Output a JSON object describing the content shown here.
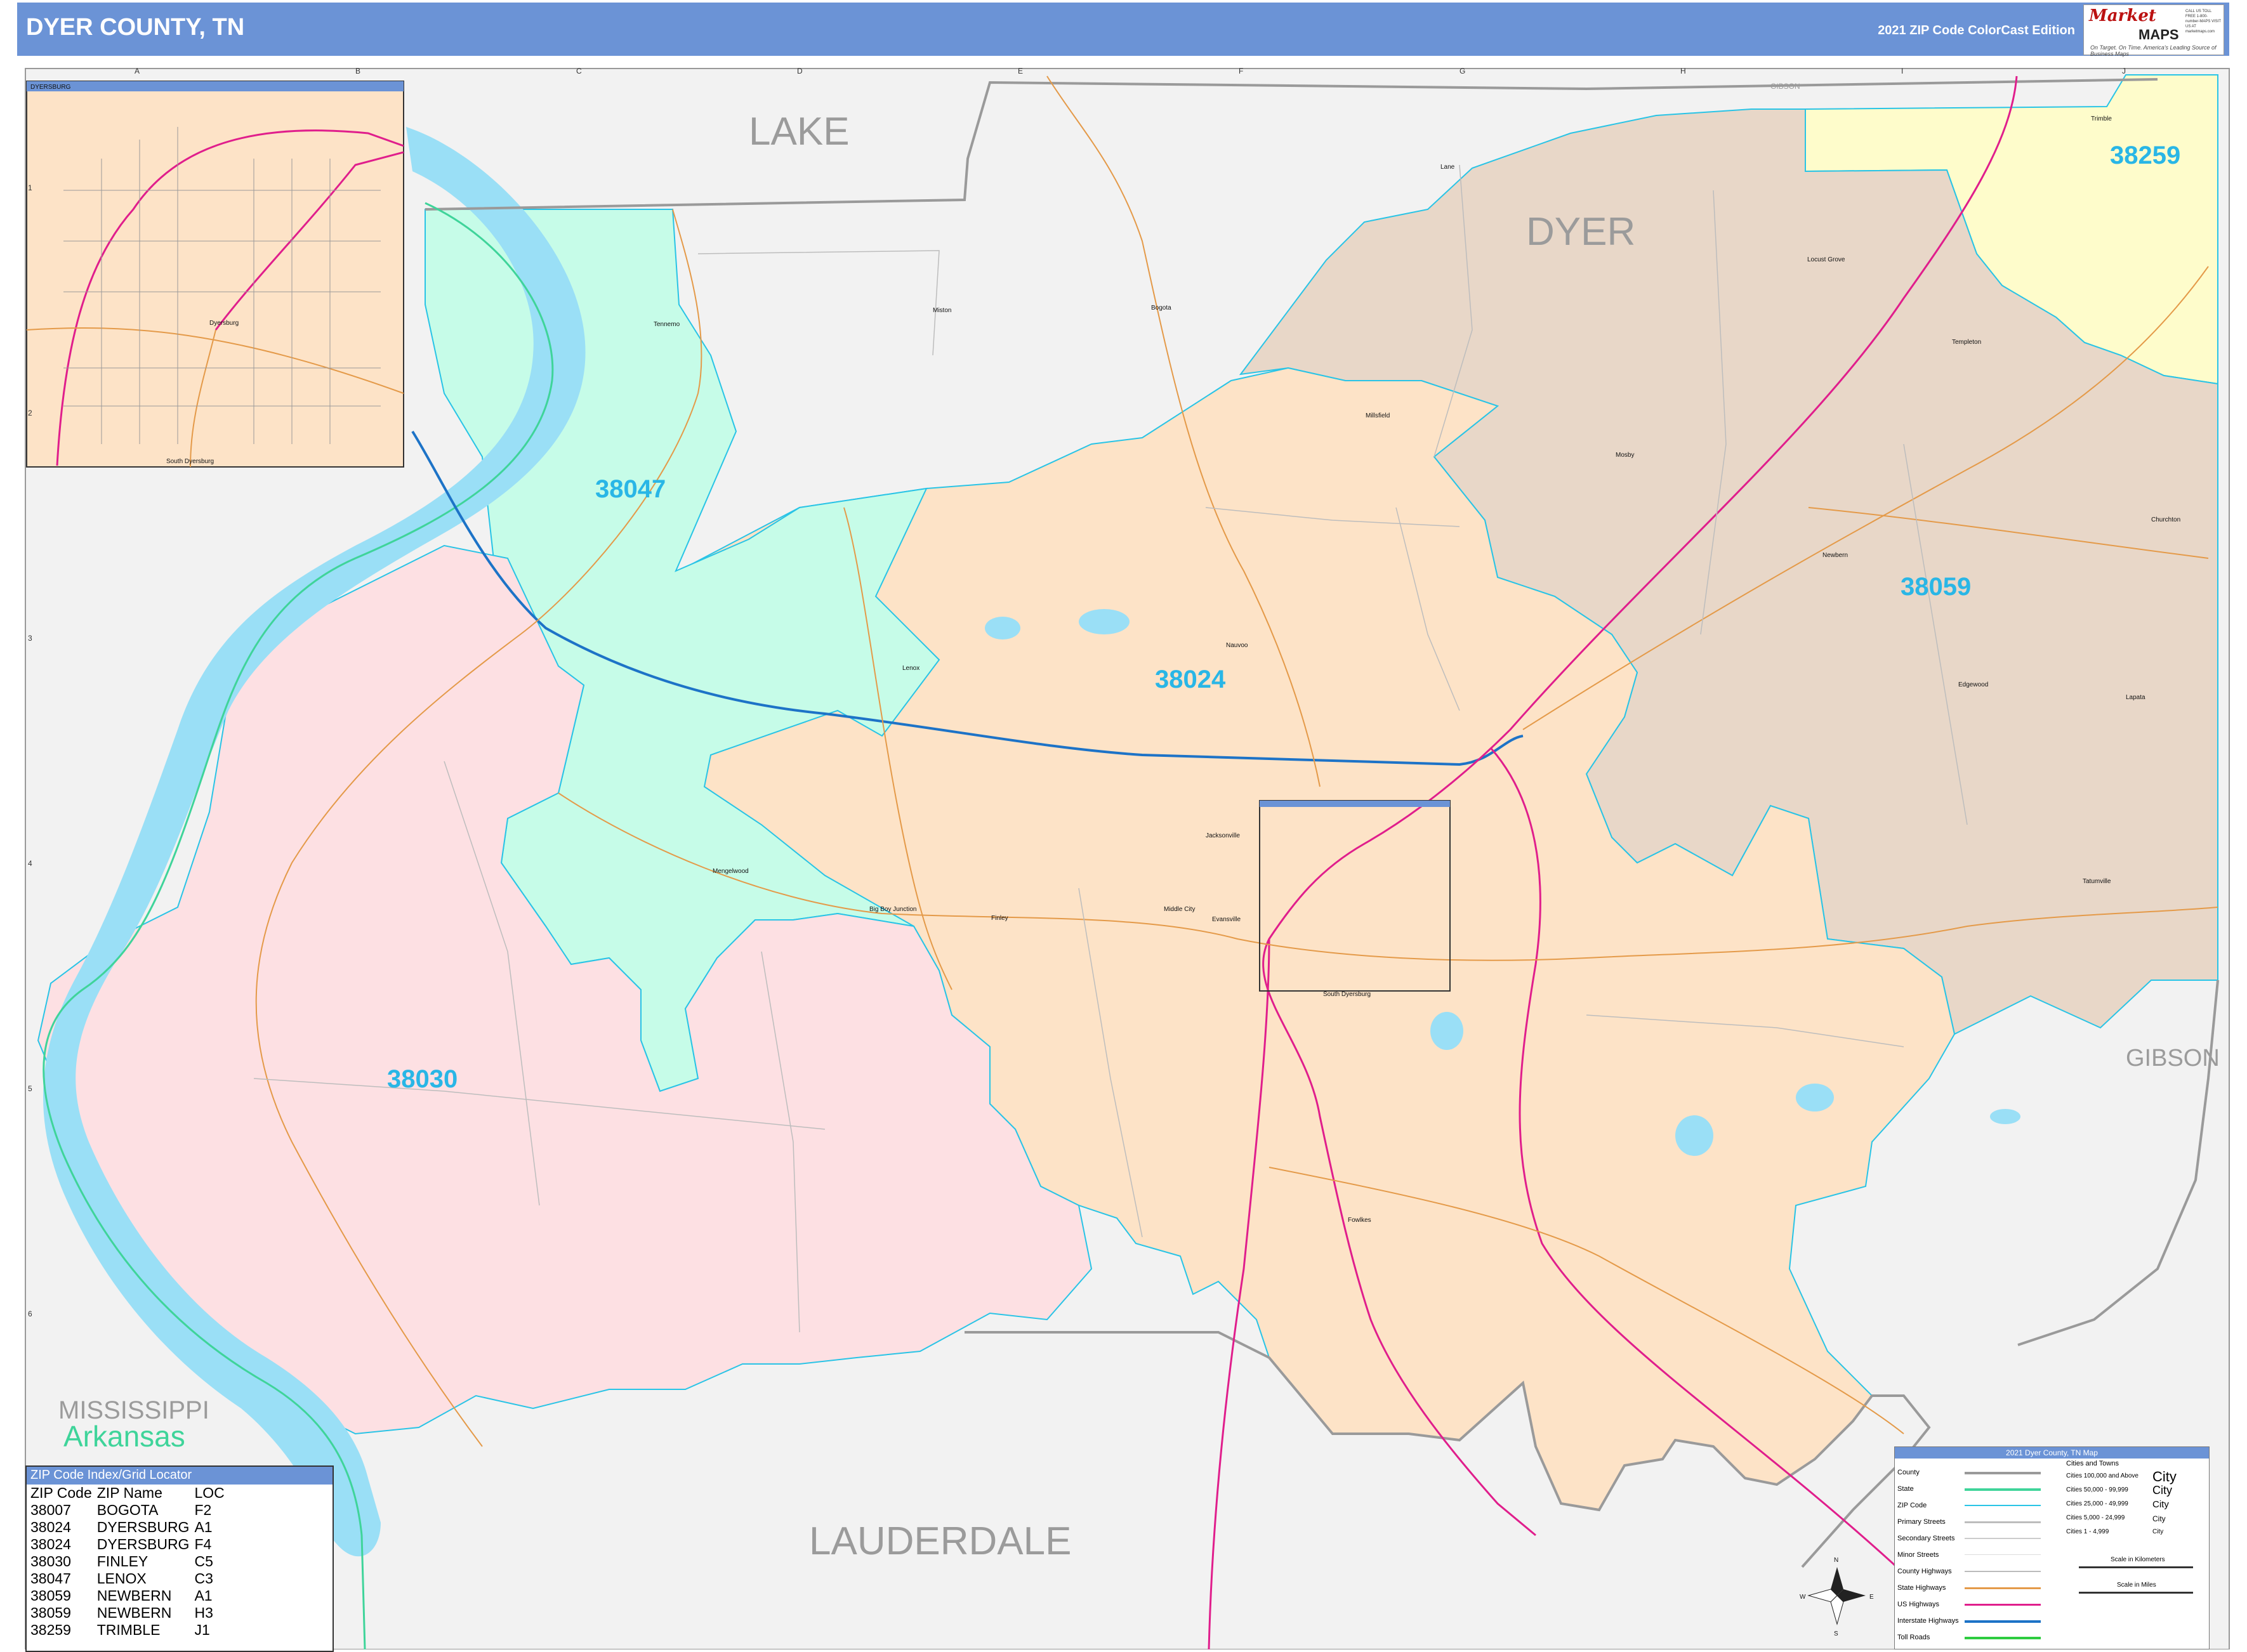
{
  "header": {
    "title": "DYER COUNTY, TN",
    "edition": "2021 ZIP Code ColorCast Edition"
  },
  "logo": {
    "brand_top": "Market",
    "brand_bottom": "MAPS",
    "tagline": "On Target. On Time. America's Leading Source of Business Maps",
    "contact": "CALL US TOLL FREE 1-800-number-MAPS VISIT US AT marketmaps.com"
  },
  "grid": {
    "columns": [
      "A",
      "B",
      "C",
      "D",
      "E",
      "F",
      "G",
      "H",
      "I",
      "J"
    ],
    "rows": [
      "1",
      "2",
      "3",
      "4",
      "5",
      "6"
    ]
  },
  "counties": {
    "lake": "LAKE",
    "dyer": "DYER",
    "gibson": "GIBSON",
    "lauderdale": "LAUDERDALE",
    "mississippi": "MISSISSIPPI",
    "arkansas": "Arkansas",
    "gibson_small": "GIBSON"
  },
  "zip_labels": {
    "z38047": "38047",
    "z38024": "38024",
    "z38059": "38059",
    "z38030": "38030",
    "z38259": "38259"
  },
  "zip_colors": {
    "38024": "#fde3c7",
    "38030": "#fde0e3",
    "38047": "#c6fce8",
    "38059": "#e8d7c8",
    "38259": "#fefccb",
    "outside": "#f2f2f2",
    "water": "#9adff6",
    "header": "#6b93d6"
  },
  "places": {
    "lane": "Lane",
    "tennemo": "Tennemo",
    "miston": "Miston",
    "bogota": "Bogota",
    "lenox": "Lenox",
    "mengelwood": "Mengelwood",
    "big_boy_junction": "Big Boy Junction",
    "finley": "Finley",
    "middle_city": "Middle City",
    "evansville": "Evansville",
    "jacksonville": "Jacksonville",
    "south_dyersburg": "South Dyersburg",
    "fowlkes": "Fowlkes",
    "millsfield": "Millsfield",
    "nauvoo": "Nauvoo",
    "mosby": "Mosby",
    "newbern": "Newbern",
    "churchton": "Churchton",
    "edgewood": "Edgewood",
    "lapata": "Lapata",
    "tatumville": "Tatumville",
    "locust_grove": "Locust Grove",
    "templeton": "Templeton",
    "trimble": "Trimble",
    "dyersburg": "Dyersburg",
    "inset_title": "DYERSBURG",
    "inset_south": "South Dyersburg"
  },
  "zip_index": {
    "title": "ZIP Code Index/Grid Locator",
    "headers": [
      "ZIP Code",
      "ZIP Name",
      "LOC"
    ],
    "rows": [
      [
        "38007",
        "BOGOTA",
        "F2"
      ],
      [
        "38024",
        "DYERSBURG",
        "A1"
      ],
      [
        "38024",
        "DYERSBURG",
        "F4"
      ],
      [
        "38030",
        "FINLEY",
        "C5"
      ],
      [
        "38047",
        "LENOX",
        "C3"
      ],
      [
        "38059",
        "NEWBERN",
        "A1"
      ],
      [
        "38059",
        "NEWBERN",
        "H3"
      ],
      [
        "38259",
        "TRIMBLE",
        "J1"
      ]
    ]
  },
  "legend": {
    "title": "2021 Dyer County, TN Map",
    "items": [
      "County",
      "State",
      "ZIP Code",
      "Primary Streets",
      "Secondary Streets",
      "Minor Streets",
      "County Highways",
      "State Highways",
      "US Highways",
      "Interstate Highways",
      "Toll Roads"
    ],
    "cities_title": "Cities and Towns",
    "city_classes": [
      "Cities 100,000 and Above",
      "Cities 50,000 - 99,999",
      "Cities 25,000 - 49,999",
      "Cities 5,000 - 24,999",
      "Cities 1 - 4,999"
    ],
    "city_symbols": [
      "City",
      "City",
      "City",
      "City",
      "City"
    ],
    "scale_km": "Scale in Kilometers",
    "scale_mi": "Scale in Miles"
  },
  "compass": {
    "n": "N",
    "s": "S",
    "e": "E",
    "w": "W"
  }
}
